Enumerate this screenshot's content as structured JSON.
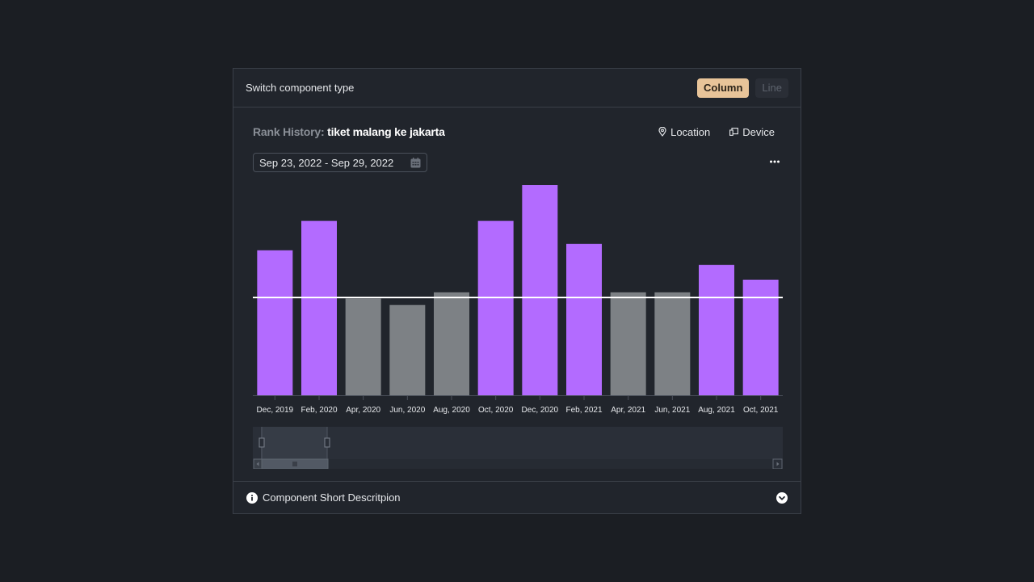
{
  "header": {
    "label": "Switch component type",
    "buttons": [
      {
        "label": "Column",
        "active": true
      },
      {
        "label": "Line",
        "active": false
      }
    ]
  },
  "title": {
    "prefix": "Rank History:",
    "keyword": "tiket malang ke jakarta"
  },
  "filters": {
    "location": "Location",
    "device": "Device"
  },
  "date_range": "Sep 23, 2022 - Sep 29, 2022",
  "footer": {
    "label": "Component Short Descritpion"
  },
  "colors": {
    "above": "#b36bff",
    "below": "#7d8185",
    "threshold_line": "#ffffff",
    "active_button": "#e8c499"
  },
  "chart_data": {
    "type": "bar",
    "title": "Rank History: tiket malang ke jakarta",
    "xlabel": "",
    "ylabel": "",
    "categories": [
      "Dec, 2019",
      "Feb, 2020",
      "Apr, 2020",
      "Jun, 2020",
      "Aug, 2020",
      "Oct, 2020",
      "Dec, 2020",
      "Feb, 2021",
      "Apr, 2021",
      "Jun, 2021",
      "Aug, 2021",
      "Oct, 2021"
    ],
    "values": [
      69,
      83,
      46,
      43,
      49,
      83,
      100,
      72,
      49,
      49,
      62,
      55
    ],
    "threshold": 50,
    "ylim": [
      0,
      100
    ],
    "grid": false,
    "legend": "none",
    "note": "values are relative (no y-axis labels shown); bars above threshold colored purple, below gray"
  }
}
